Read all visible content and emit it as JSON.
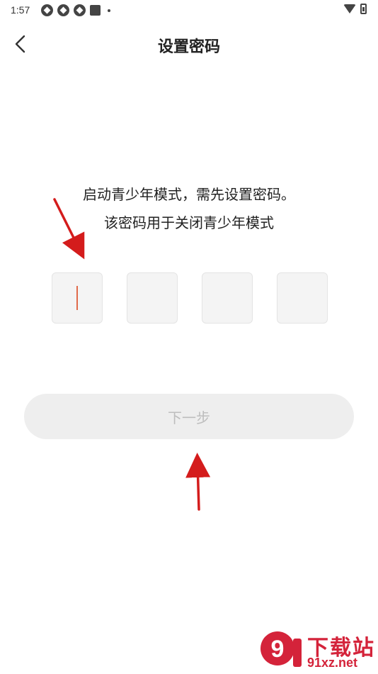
{
  "status_bar": {
    "time": "1:57",
    "icons": [
      "app-icon",
      "app-icon",
      "app-icon",
      "square-icon",
      "dot-icon"
    ],
    "right_icons": [
      "wifi-icon",
      "battery-icon"
    ]
  },
  "header": {
    "title": "设置密码",
    "back_icon": "chevron-left-icon"
  },
  "instructions": {
    "line1": "启动青少年模式，需先设置密码。",
    "line2": "该密码用于关闭青少年模式"
  },
  "pin": {
    "length": 4,
    "active_index": 0
  },
  "next_button": {
    "label": "下一步",
    "enabled": false
  },
  "watermark": {
    "logo_text": "9",
    "text_cn": "下载站",
    "text_en": "91xz.net"
  },
  "colors": {
    "cursor": "#e06a4a",
    "arrow": "#d41c1c",
    "watermark": "#d4233a",
    "button_bg": "#eeeeee",
    "button_text": "#bdbdbd"
  }
}
